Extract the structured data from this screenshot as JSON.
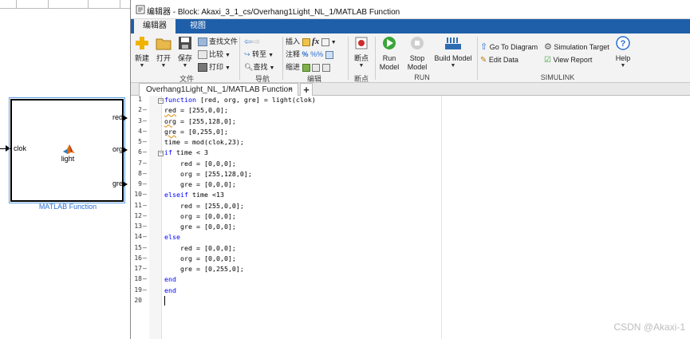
{
  "simulink": {
    "block_name": "light",
    "block_caption": "MATLAB Function",
    "input_port": "clok",
    "output_ports": [
      "red",
      "org",
      "gre"
    ]
  },
  "window": {
    "title": "编辑器 - Block: Akaxi_3_1_cs/Overhang1Light_NL_1/MATLAB Function"
  },
  "ribbon": {
    "tabs": [
      "编辑器",
      "视图"
    ],
    "file": {
      "new": "新建",
      "open": "打开",
      "save": "保存",
      "find_files": "查找文件",
      "compare": "比较",
      "print": "打印",
      "group": "文件"
    },
    "navigate": {
      "goto": "转至",
      "find": "查找",
      "group": "导航"
    },
    "edit": {
      "insert": "插入",
      "comment": "注释",
      "indent": "缩进",
      "fx": "fx",
      "comment_symbol": "%",
      "group": "编辑"
    },
    "breakpoints": {
      "label": "断点",
      "group": "断点"
    },
    "run": {
      "run": "Run",
      "run2": "Model",
      "stop": "Stop",
      "stop2": "Model",
      "build": "Build Model",
      "group": "RUN"
    },
    "simulink": {
      "goto_diagram": "Go To Diagram",
      "sim_target": "Simulation Target",
      "edit_data": "Edit Data",
      "view_report": "View Report",
      "help": "Help",
      "group": "SIMULINK"
    }
  },
  "doc_tab": {
    "label": "Overhang1Light_NL_1/MATLAB Function",
    "close": "×",
    "add": "+"
  },
  "code": {
    "lines": [
      "function [red, org, gre] = light(clok)",
      "red = [255,0,0];",
      "org = [255,128,0];",
      "gre = [0,255,0];",
      "time = mod(clok,23);",
      "if time < 3",
      "    red = [0,0,0];",
      "    org = [255,128,0];",
      "    gre = [0,0,0];",
      "elseif time <13",
      "    red = [255,0,0];",
      "    org = [0,0,0];",
      "    gre = [0,0,0];",
      "else",
      "    red = [0,0,0];",
      "    org = [0,0,0];",
      "    gre = [0,255,0];",
      "end",
      "end",
      ""
    ],
    "line_numbers": [
      "1",
      "2",
      "3",
      "4",
      "5",
      "6",
      "7",
      "8",
      "9",
      "10",
      "11",
      "12",
      "13",
      "14",
      "15",
      "16",
      "17",
      "18",
      "19",
      "20"
    ]
  },
  "watermark": "CSDN @Akaxi-1",
  "colors": {
    "tab_bar": "#1f5fa9",
    "keyword": "#0000ff",
    "caption": "#2a6fd1"
  }
}
